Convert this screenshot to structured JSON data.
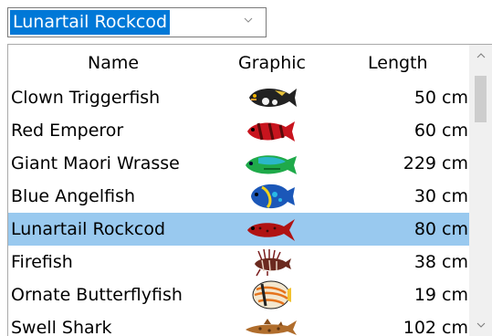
{
  "combo": {
    "value": "Lunartail Rockcod",
    "arrow_icon": "chevron-down-icon"
  },
  "columns": {
    "name": "Name",
    "graphic": "Graphic",
    "length": "Length"
  },
  "rows": [
    {
      "name": "Clown Triggerfish",
      "length": "50 cm",
      "graphic": "clown-triggerfish-icon",
      "selected": false
    },
    {
      "name": "Red Emperor",
      "length": "60 cm",
      "graphic": "red-emperor-icon",
      "selected": false
    },
    {
      "name": "Giant Maori Wrasse",
      "length": "229 cm",
      "graphic": "giant-maori-wrasse-icon",
      "selected": false
    },
    {
      "name": "Blue Angelfish",
      "length": "30 cm",
      "graphic": "blue-angelfish-icon",
      "selected": false
    },
    {
      "name": "Lunartail Rockcod",
      "length": "80 cm",
      "graphic": "lunartail-rockcod-icon",
      "selected": true
    },
    {
      "name": "Firefish",
      "length": "38 cm",
      "graphic": "firefish-icon",
      "selected": false
    },
    {
      "name": "Ornate Butterflyfish",
      "length": "19 cm",
      "graphic": "ornate-butterflyfish-icon",
      "selected": false
    },
    {
      "name": "Swell Shark",
      "length": "102 cm",
      "graphic": "swell-shark-icon",
      "selected": false
    }
  ],
  "colors": {
    "selection": "#99c9ef",
    "combo_highlight": "#0078d7",
    "scrollbar_track": "#f0f0f0",
    "scrollbar_thumb": "#cdcdcd"
  }
}
